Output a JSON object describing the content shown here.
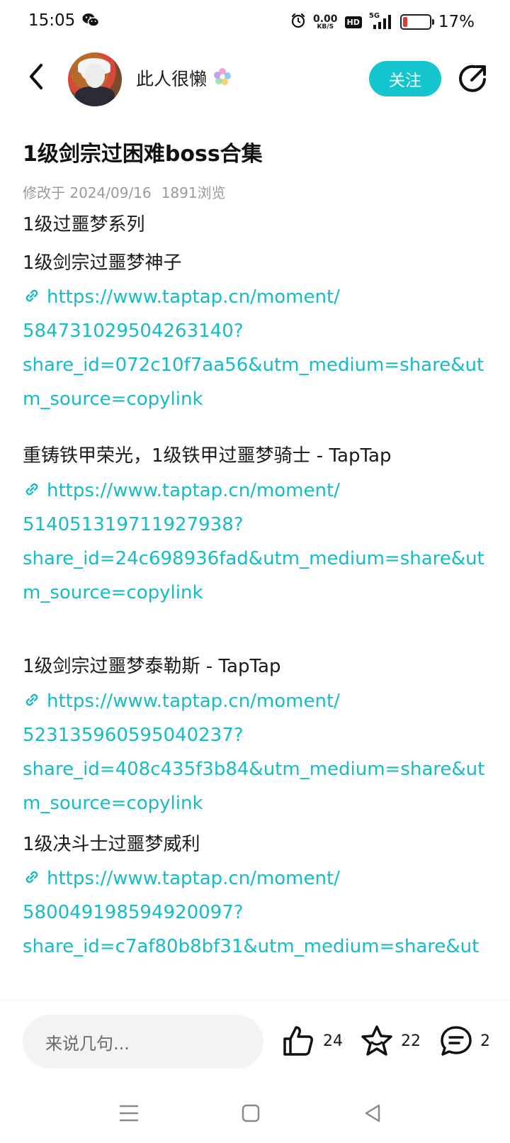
{
  "status_bar": {
    "time": "15:05",
    "net_speed_value": "0.00",
    "net_speed_unit": "KB/S",
    "hd_label": "HD",
    "signal_label": "5G",
    "battery_percent": "17%",
    "battery_level": 0.17,
    "battery_color": "#e53935"
  },
  "header": {
    "username": "此人很懒",
    "follow_label": "关注",
    "accent_color": "#15c5ce"
  },
  "post": {
    "title": "1级剑宗过困难boss合集",
    "modified": "修改于 2024/09/16",
    "views": "1891浏览",
    "blocks": [
      {
        "type": "text",
        "text": "1级过噩梦系列"
      },
      {
        "type": "text",
        "text": "1级剑宗过噩梦神子"
      },
      {
        "type": "link",
        "lines": [
          "https://www.taptap.cn/moment/",
          "584731029504263140?",
          "share_id=072c10f7aa56&utm_medium=share&ut",
          "m_source=copylink"
        ]
      },
      {
        "type": "text",
        "text": "重铸铁甲荣光，1级铁甲过噩梦骑士 - TapTap"
      },
      {
        "type": "link",
        "lines": [
          "https://www.taptap.cn/moment/",
          "514051319711927938?",
          "share_id=24c698936fad&utm_medium=share&ut",
          "m_source=copylink"
        ]
      },
      {
        "type": "text",
        "text": "1级剑宗过噩梦泰勒斯 - TapTap"
      },
      {
        "type": "link",
        "lines": [
          "https://www.taptap.cn/moment/",
          "523135960595040237?",
          "share_id=408c435f3b84&utm_medium=share&ut",
          "m_source=copylink"
        ]
      },
      {
        "type": "text",
        "text": "1级决斗士过噩梦威利"
      },
      {
        "type": "link",
        "lines": [
          "https://www.taptap.cn/moment/",
          "580049198594920097?",
          "share_id=c7af80b8bf31&utm_medium=share&ut"
        ]
      }
    ]
  },
  "bottom_bar": {
    "comment_placeholder": "来说几句...",
    "likes": "24",
    "favorites": "22",
    "comments": "2"
  },
  "icons": {
    "back": "chevron-left-icon",
    "share": "share-arrow-icon",
    "link": "link-icon",
    "like": "thumbs-up-icon",
    "favorite": "star-icon",
    "comment": "comment-bubble-icon",
    "nav_menu": "menu-icon",
    "nav_home": "square-icon",
    "nav_back": "triangle-back-icon"
  }
}
